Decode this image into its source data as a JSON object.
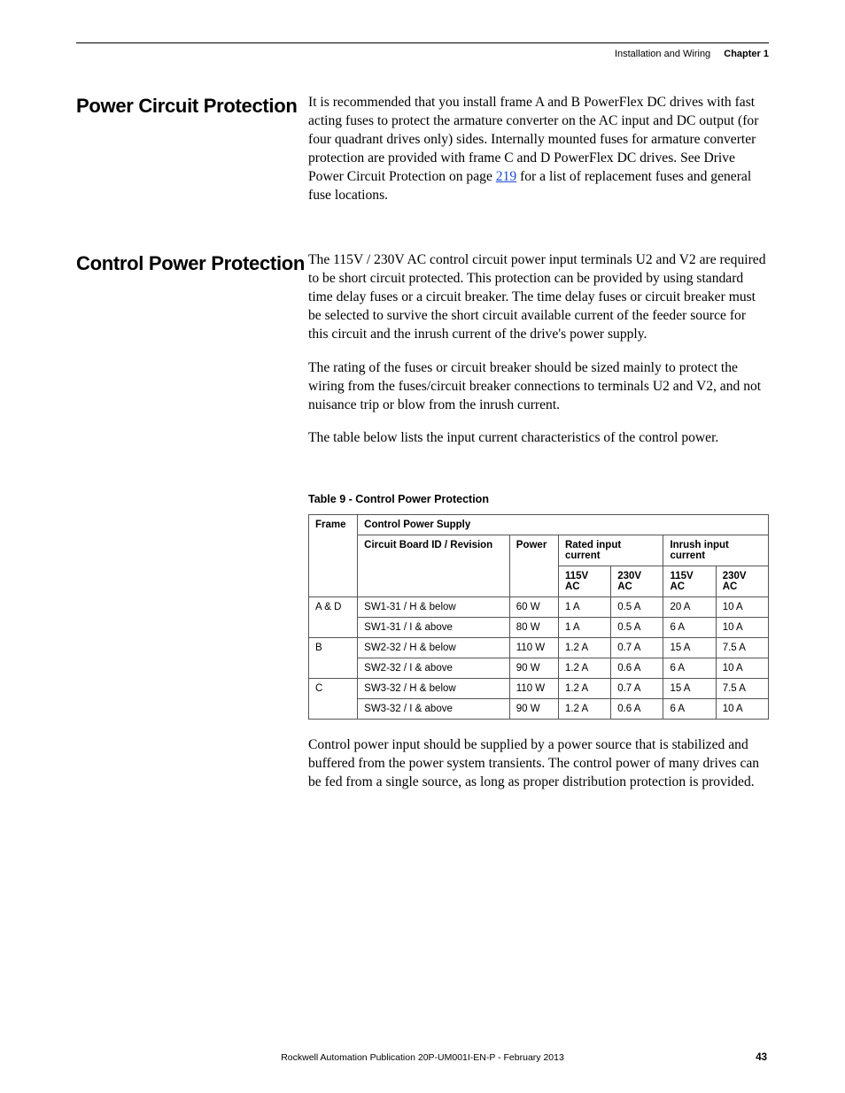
{
  "header": {
    "section": "Installation and Wiring",
    "chapter": "Chapter 1"
  },
  "sections": {
    "s1": {
      "heading": "Power Circuit Protection",
      "p1a": "It is recommended that you install frame A and B PowerFlex DC drives with fast acting fuses to protect the armature converter on the AC input and DC output (for four quadrant drives only) sides. Internally mounted fuses for armature converter protection are provided with frame C and D PowerFlex DC drives. See Drive Power Circuit Protection on page ",
      "p1link": "219",
      "p1b": " for a list of replacement fuses and general fuse locations."
    },
    "s2": {
      "heading": "Control Power Protection",
      "p1": "The 115V / 230V AC control circuit power input terminals U2 and V2 are required to be short circuit protected. This protection can be provided by using standard time delay fuses or a circuit breaker. The time delay fuses or circuit breaker must be selected to survive the short circuit available current of the feeder source for this circuit and the inrush current of the drive's power supply.",
      "p2": "The rating of the fuses or circuit breaker should be sized mainly to protect the wiring from the fuses/circuit breaker connections to terminals U2 and V2, and not nuisance trip or blow from the inrush current.",
      "p3": "The table below lists the input current characteristics of the control power."
    }
  },
  "table": {
    "caption": "Table 9 - Control Power Protection",
    "head": {
      "frame": "Frame",
      "cps": "Control Power Supply",
      "board": "Circuit Board ID / Revision",
      "power": "Power",
      "rated": "Rated input current",
      "inrush": "Inrush input current",
      "v115": "115V AC",
      "v230": "230V AC"
    },
    "rows": [
      {
        "frame": "A & D",
        "board": "SW1-31 / H & below",
        "power": "60 W",
        "r115": "1 A",
        "r230": "0.5 A",
        "i115": "20 A",
        "i230": "10 A"
      },
      {
        "frame": "",
        "board": "SW1-31 / I & above",
        "power": "80 W",
        "r115": "1 A",
        "r230": "0.5 A",
        "i115": "6 A",
        "i230": "10 A"
      },
      {
        "frame": "B",
        "board": "SW2-32 / H & below",
        "power": "110 W",
        "r115": "1.2 A",
        "r230": "0.7 A",
        "i115": "15 A",
        "i230": "7.5 A"
      },
      {
        "frame": "",
        "board": "SW2-32 / I & above",
        "power": "90 W",
        "r115": "1.2 A",
        "r230": "0.6 A",
        "i115": "6 A",
        "i230": "10 A"
      },
      {
        "frame": "C",
        "board": "SW3-32 / H & below",
        "power": "110 W",
        "r115": "1.2 A",
        "r230": "0.7 A",
        "i115": "15 A",
        "i230": "7.5 A"
      },
      {
        "frame": "",
        "board": "SW3-32 / I & above",
        "power": "90 W",
        "r115": "1.2 A",
        "r230": "0.6 A",
        "i115": "6 A",
        "i230": "10 A"
      }
    ]
  },
  "afterTable": "Control power input should be supplied by a power source that is stabilized and buffered from the power system transients. The control power of many drives can be fed from a single source, as long as proper distribution protection is provided.",
  "footer": {
    "pub": "Rockwell Automation Publication 20P-UM001I-EN-P - February 2013",
    "page": "43"
  }
}
